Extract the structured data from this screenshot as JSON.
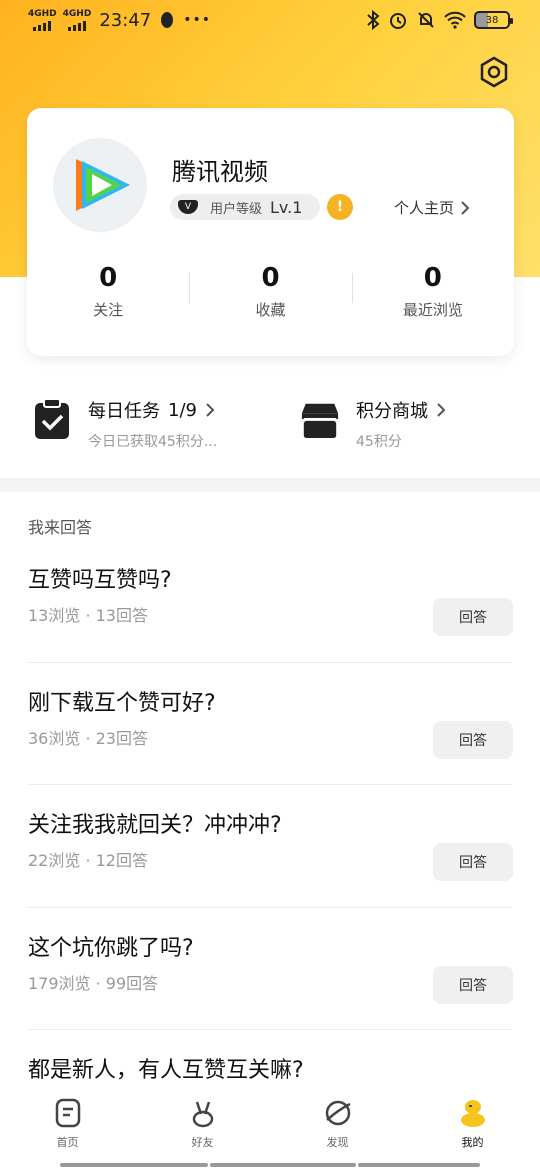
{
  "status_bar": {
    "signal1": "4GHD",
    "signal2": "4GHD",
    "time": "23:47",
    "more": "•••",
    "battery": "38"
  },
  "profile": {
    "name": "腾讯视频",
    "level_label": "用户等级",
    "level": "Lv.1",
    "profile_link": "个人主页"
  },
  "stats": [
    {
      "value": "0",
      "label": "关注"
    },
    {
      "value": "0",
      "label": "收藏"
    },
    {
      "value": "0",
      "label": "最近浏览"
    }
  ],
  "tasks": {
    "daily": {
      "title": "每日任务",
      "progress": "1/9",
      "subtitle": "今日已获取45积分..."
    },
    "store": {
      "title": "积分商城",
      "subtitle": "45积分"
    }
  },
  "answer_section": {
    "title": "我来回答",
    "button_label": "回答",
    "questions": [
      {
        "title": "互赞吗互赞吗?",
        "meta": "13浏览 · 13回答"
      },
      {
        "title": "刚下载互个赞可好?",
        "meta": "36浏览 · 23回答"
      },
      {
        "title": "关注我我就回关？冲冲冲?",
        "meta": "22浏览 · 12回答"
      },
      {
        "title": "这个坑你跳了吗?",
        "meta": "179浏览 · 99回答"
      },
      {
        "title": "都是新人，有人互赞互关嘛?",
        "meta": ""
      }
    ]
  },
  "bottom_nav": [
    {
      "label": "首页",
      "icon": "home-icon"
    },
    {
      "label": "好友",
      "icon": "friends-icon"
    },
    {
      "label": "发现",
      "icon": "discover-planet-icon"
    },
    {
      "label": "我的",
      "icon": "me-mascot-icon"
    }
  ],
  "colors": {
    "header_gradient_start": "#ffb21e",
    "header_gradient_end": "#ffe06a",
    "mascot": "#f7c41e"
  }
}
